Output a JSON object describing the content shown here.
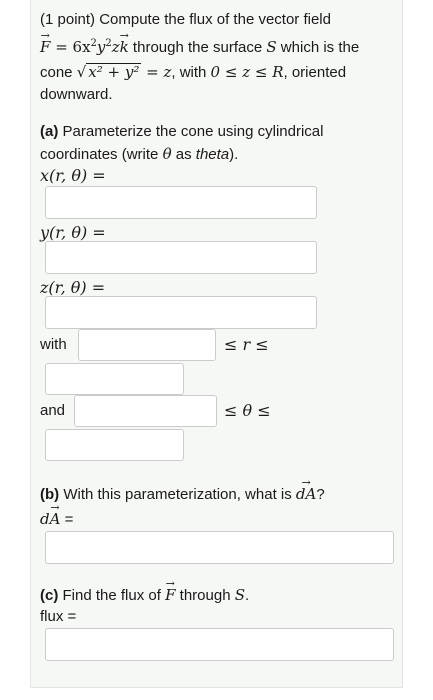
{
  "problem": {
    "line1": "(1 point) Compute the flux of the vector field",
    "field_F": "F",
    "field_eq": " = 6x",
    "field_rest1": "y",
    "field_rest2": "z",
    "field_k": "k",
    "field_through": " through the surface ",
    "field_S": "S",
    "field_which": " which is the",
    "cone_word": "cone ",
    "cone_expr": "x² + y²",
    "cone_eq": " = z",
    "cone_with": ", with ",
    "cone_range": "0 ≤ z ≤ R",
    "cone_oriented": ", oriented",
    "line4": "downward."
  },
  "part_a": {
    "label": "(a)",
    "text1": " Parameterize the cone using cylindrical",
    "text2a": "coordinates (write ",
    "theta": "θ",
    "text2b": " as ",
    "theta_word": "theta",
    "text2c": ").",
    "x_label": "x(r, θ) =",
    "y_label": "y(r, θ) =",
    "z_label": "z(r, θ) =",
    "with_label": "with",
    "r_ineq": "≤ r ≤",
    "and_label": "and",
    "theta_ineq": "≤ θ ≤"
  },
  "part_b": {
    "label": "(b)",
    "text": " With this parameterization, what is ",
    "dA": "dA",
    "q": "?",
    "answer_label_d": "d",
    "answer_label_A": "A",
    "answer_label_eq": " ="
  },
  "part_c": {
    "label": "(c)",
    "text1": " Find the flux of ",
    "F": "F",
    "text2": " through ",
    "S": "S",
    "dot": ".",
    "flux_label": "flux ="
  }
}
